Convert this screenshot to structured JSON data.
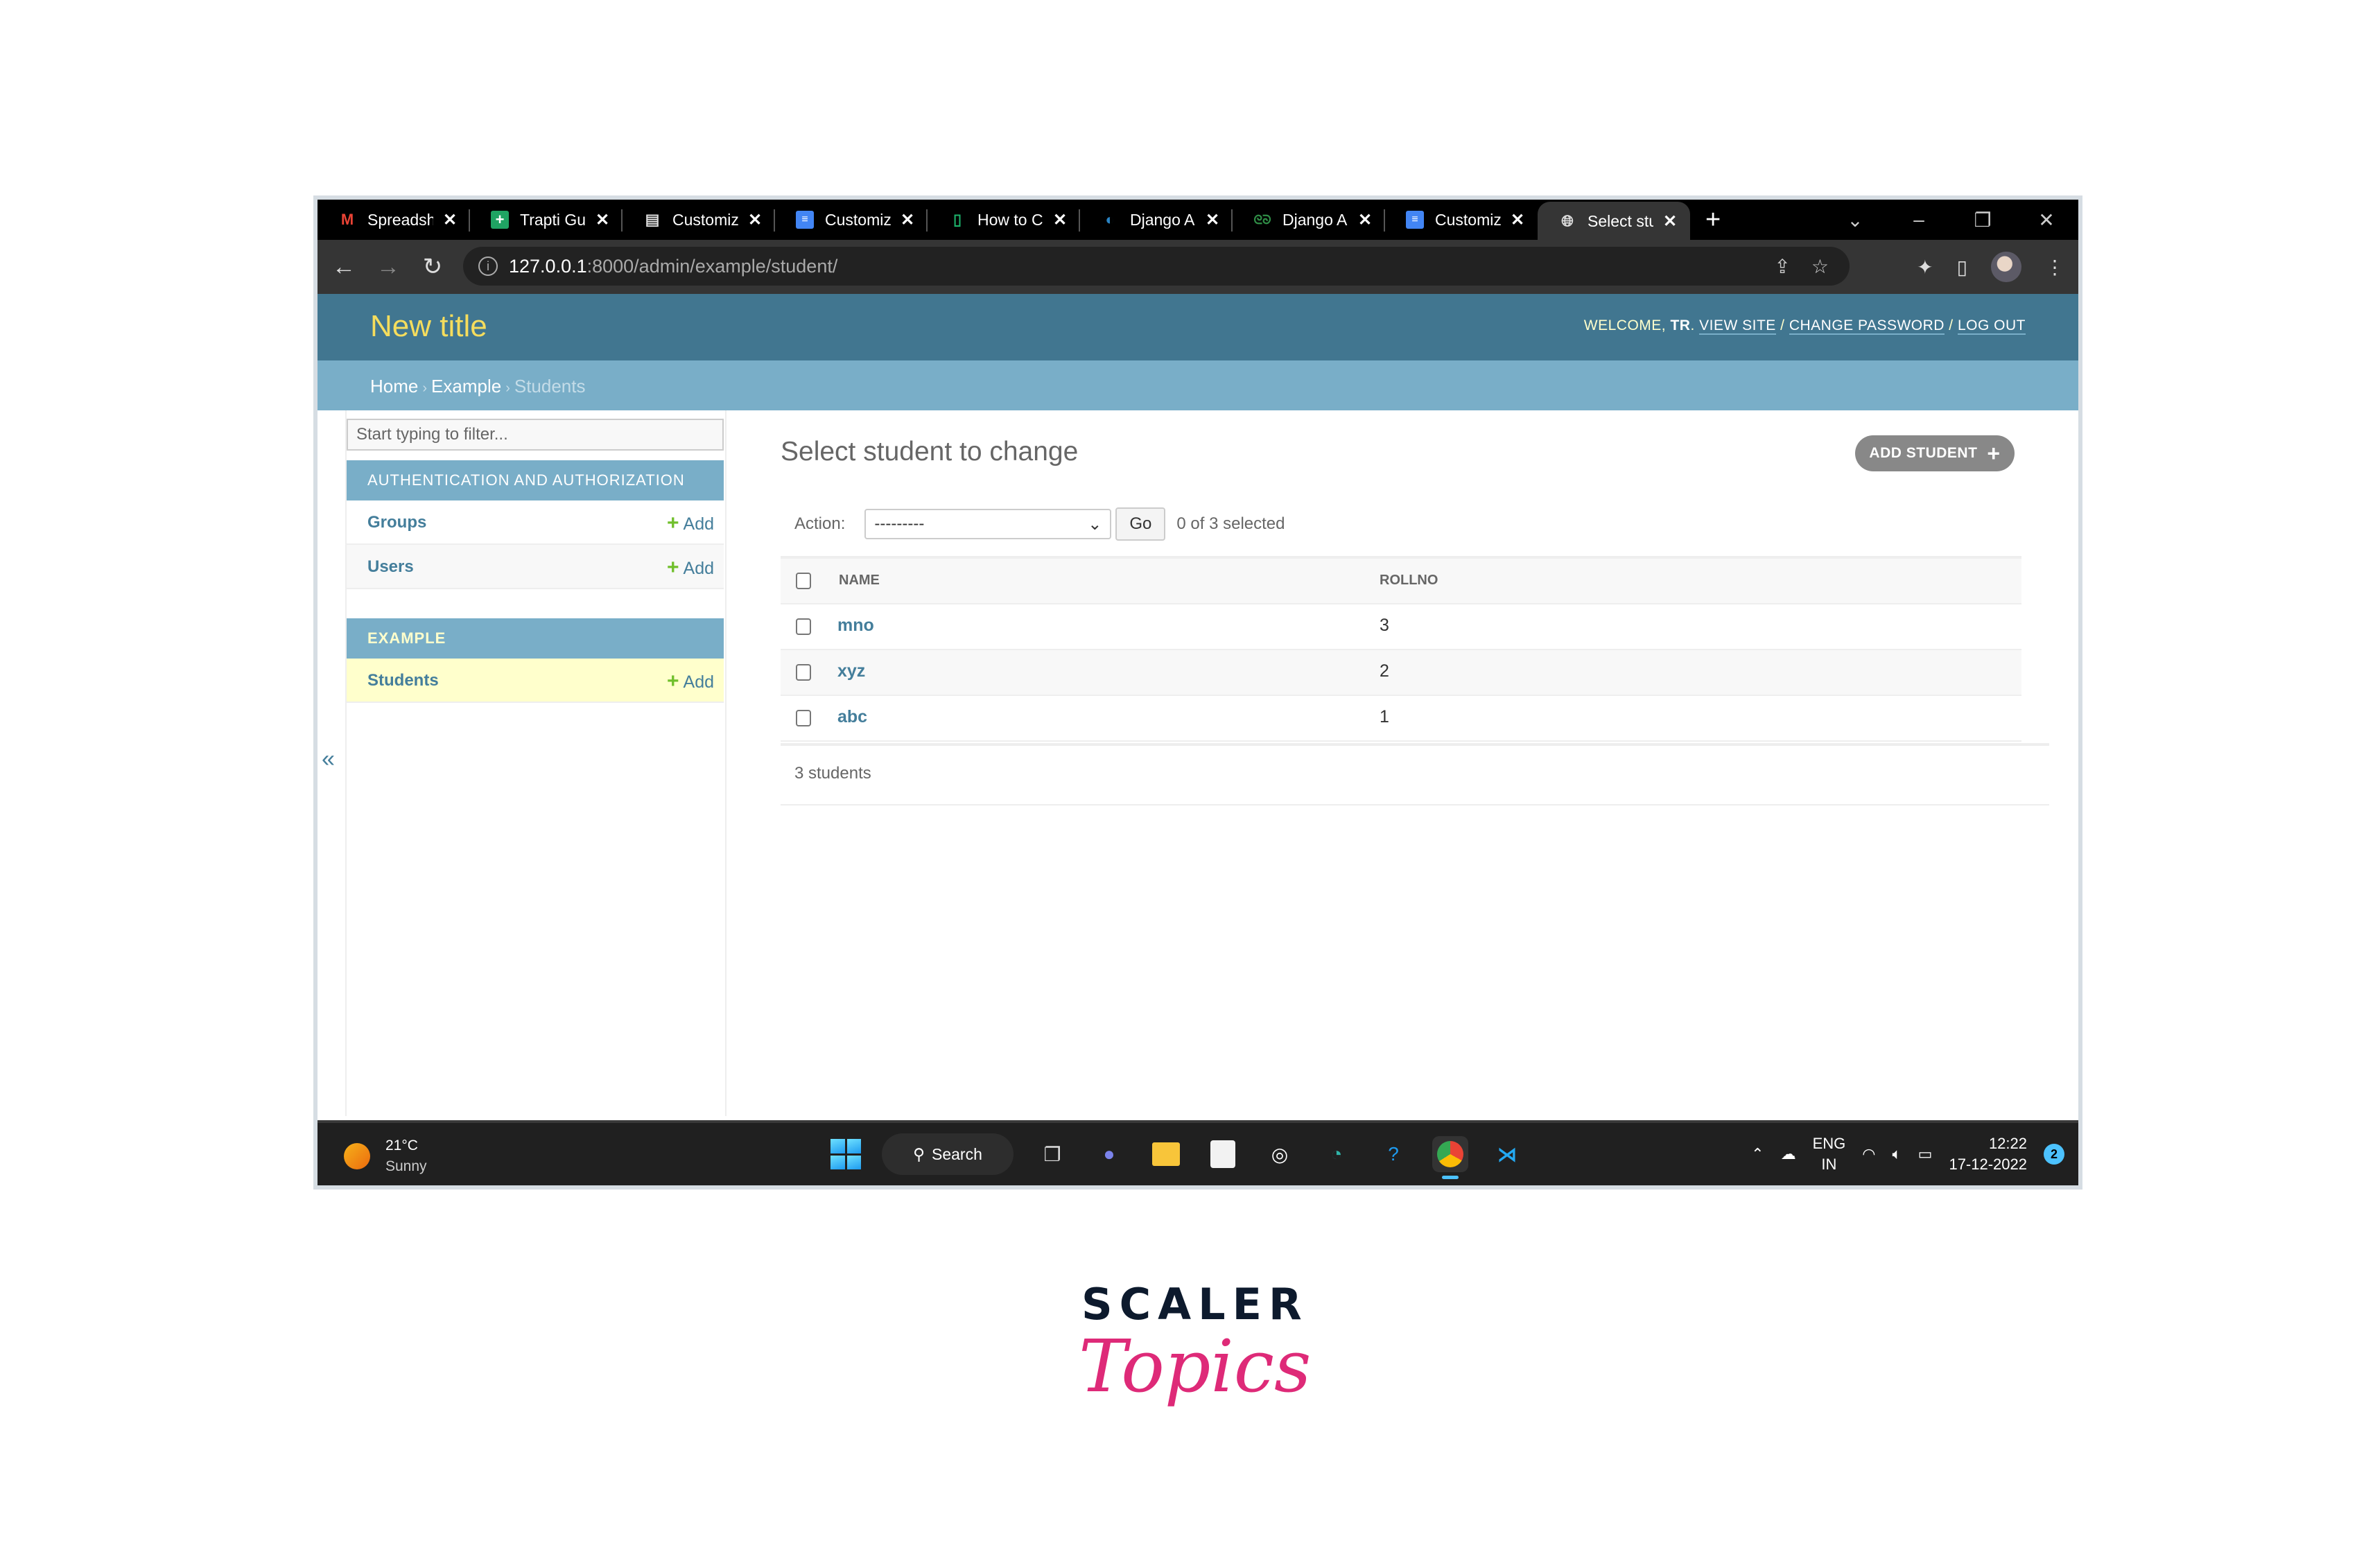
{
  "browser": {
    "tabs": [
      {
        "label": "Spreadsh",
        "icon": "gmail-icon",
        "active": false
      },
      {
        "label": "Trapti Gu",
        "icon": "sheets-icon",
        "active": false
      },
      {
        "label": "Customiz",
        "icon": "document-icon",
        "active": false
      },
      {
        "label": "Customiz",
        "icon": "docs-icon",
        "active": false
      },
      {
        "label": "How to C",
        "icon": "notebook-icon",
        "active": false
      },
      {
        "label": "Django A",
        "icon": "django-icon",
        "active": false
      },
      {
        "label": "Django A",
        "icon": "geeksforgeeks-icon",
        "active": false
      },
      {
        "label": "Customiz",
        "icon": "docs-icon",
        "active": false
      },
      {
        "label": "Select stu",
        "icon": "globe-icon",
        "active": true
      }
    ],
    "url_host": "127.0.0.1",
    "url_rest": ":8000/admin/example/student/"
  },
  "admin": {
    "site_title": "New title",
    "user_tools": {
      "welcome": "WELCOME,",
      "username": "TR",
      "view_site": "VIEW SITE",
      "change_password": "CHANGE PASSWORD",
      "log_out": "LOG OUT"
    },
    "breadcrumbs": [
      "Home",
      "Example",
      "Students"
    ],
    "sidebar": {
      "filter_placeholder": "Start typing to filter...",
      "apps": [
        {
          "caption": "AUTHENTICATION AND AUTHORIZATION",
          "models": [
            {
              "label": "Groups",
              "add": "Add"
            },
            {
              "label": "Users",
              "add": "Add"
            }
          ]
        },
        {
          "caption": "EXAMPLE",
          "models": [
            {
              "label": "Students",
              "add": "Add"
            }
          ]
        }
      ],
      "collapse_glyph": "«"
    },
    "content": {
      "title": "Select student to change",
      "add_button": "ADD STUDENT",
      "action_label": "Action:",
      "action_selected": "---------",
      "go_label": "Go",
      "selection_count": "0 of 3 selected",
      "columns": [
        "NAME",
        "ROLLNO"
      ],
      "rows": [
        {
          "name": "mno",
          "rollno": "3"
        },
        {
          "name": "xyz",
          "rollno": "2"
        },
        {
          "name": "abc",
          "rollno": "1"
        }
      ],
      "paginator": "3 students"
    }
  },
  "taskbar": {
    "weather_temp": "21°C",
    "weather_text": "Sunny",
    "search_label": "Search",
    "lang_top": "ENG",
    "lang_bottom": "IN",
    "time": "12:22",
    "date": "17-12-2022",
    "notifications": "2"
  },
  "branding": {
    "line1": "SCALER",
    "line2": "Topics"
  },
  "colors": {
    "header": "#417690",
    "breadcrumbs": "#79aec8",
    "site_title": "#f5dd5d",
    "link": "#447e9b",
    "add_green": "#70bf2b",
    "selected_row": "#ffffcc",
    "logo_pink": "#de2a78"
  }
}
